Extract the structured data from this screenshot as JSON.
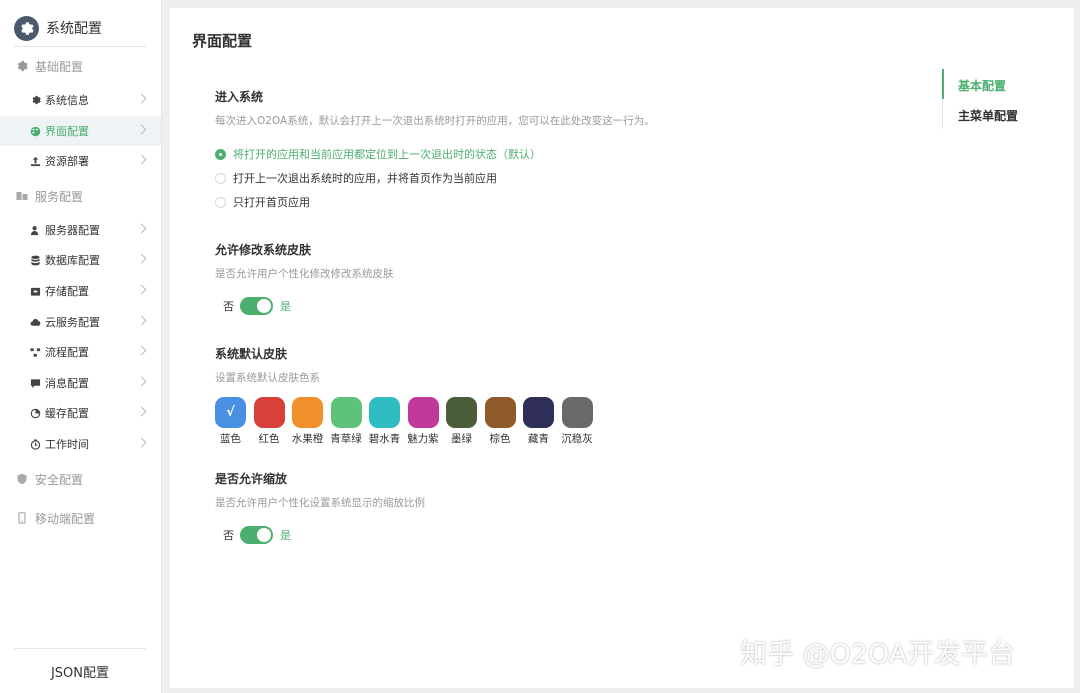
{
  "sidebar": {
    "title": "系统配置",
    "groups": {
      "basic": "基础配置",
      "service": "服务配置",
      "security": "安全配置",
      "mobile": "移动端配置"
    },
    "items": [
      {
        "label": "系统信息",
        "icon": "gear-icon"
      },
      {
        "label": "界面配置",
        "icon": "palette-icon",
        "active": true
      },
      {
        "label": "资源部署",
        "icon": "upload-icon"
      },
      {
        "label": "服务器配置",
        "icon": "user-server-icon"
      },
      {
        "label": "数据库配置",
        "icon": "database-icon"
      },
      {
        "label": "存储配置",
        "icon": "storage-icon"
      },
      {
        "label": "云服务配置",
        "icon": "cloud-icon"
      },
      {
        "label": "流程配置",
        "icon": "flow-icon"
      },
      {
        "label": "消息配置",
        "icon": "message-icon"
      },
      {
        "label": "缓存配置",
        "icon": "pie-icon"
      },
      {
        "label": "工作时间",
        "icon": "clock-icon"
      }
    ],
    "footer": "JSON配置"
  },
  "main": {
    "title": "界面配置",
    "enter": {
      "title": "进入系统",
      "desc": "每次进入O2OA系统，默认会打开上一次退出系统时打开的应用，您可以在此处改变这一行为。",
      "options": [
        "将打开的应用和当前应用都定位到上一次退出时的状态（默认）",
        "打开上一次退出系统时的应用，并将首页作为当前应用",
        "只打开首页应用"
      ],
      "selected_index": 0
    },
    "skin_change": {
      "title": "允许修改系统皮肤",
      "desc": "是否允许用户个性化修改修改系统皮肤",
      "off_label": "否",
      "on_label": "是",
      "enabled": true
    },
    "default_skin": {
      "title": "系统默认皮肤",
      "desc": "设置系统默认皮肤色系",
      "check_mark": "√",
      "swatches": [
        {
          "name": "蓝色",
          "color": "#4a90e2",
          "selected": true
        },
        {
          "name": "红色",
          "color": "#d9403a"
        },
        {
          "name": "水果橙",
          "color": "#f0902a"
        },
        {
          "name": "青草绿",
          "color": "#5ec27a"
        },
        {
          "name": "碧水青",
          "color": "#2fbcc2"
        },
        {
          "name": "魅力紫",
          "color": "#c0399a"
        },
        {
          "name": "墨绿",
          "color": "#4a5e3a"
        },
        {
          "name": "棕色",
          "color": "#8f5a2a"
        },
        {
          "name": "藏青",
          "color": "#2f2f5a"
        },
        {
          "name": "沉稳灰",
          "color": "#6a6a6a"
        }
      ]
    },
    "zoom": {
      "title": "是否允许缩放",
      "desc": "是否允许用户个性化设置系统显示的缩放比例",
      "off_label": "否",
      "on_label": "是",
      "enabled": true
    },
    "anchors": [
      {
        "label": "基本配置",
        "active": true
      },
      {
        "label": "主菜单配置"
      }
    ]
  },
  "watermark": "知乎 @O2OA开发平台",
  "colors": {
    "accent": "#4caf70",
    "active_bg": "#f0f3f5",
    "muted_text": "#999999"
  }
}
